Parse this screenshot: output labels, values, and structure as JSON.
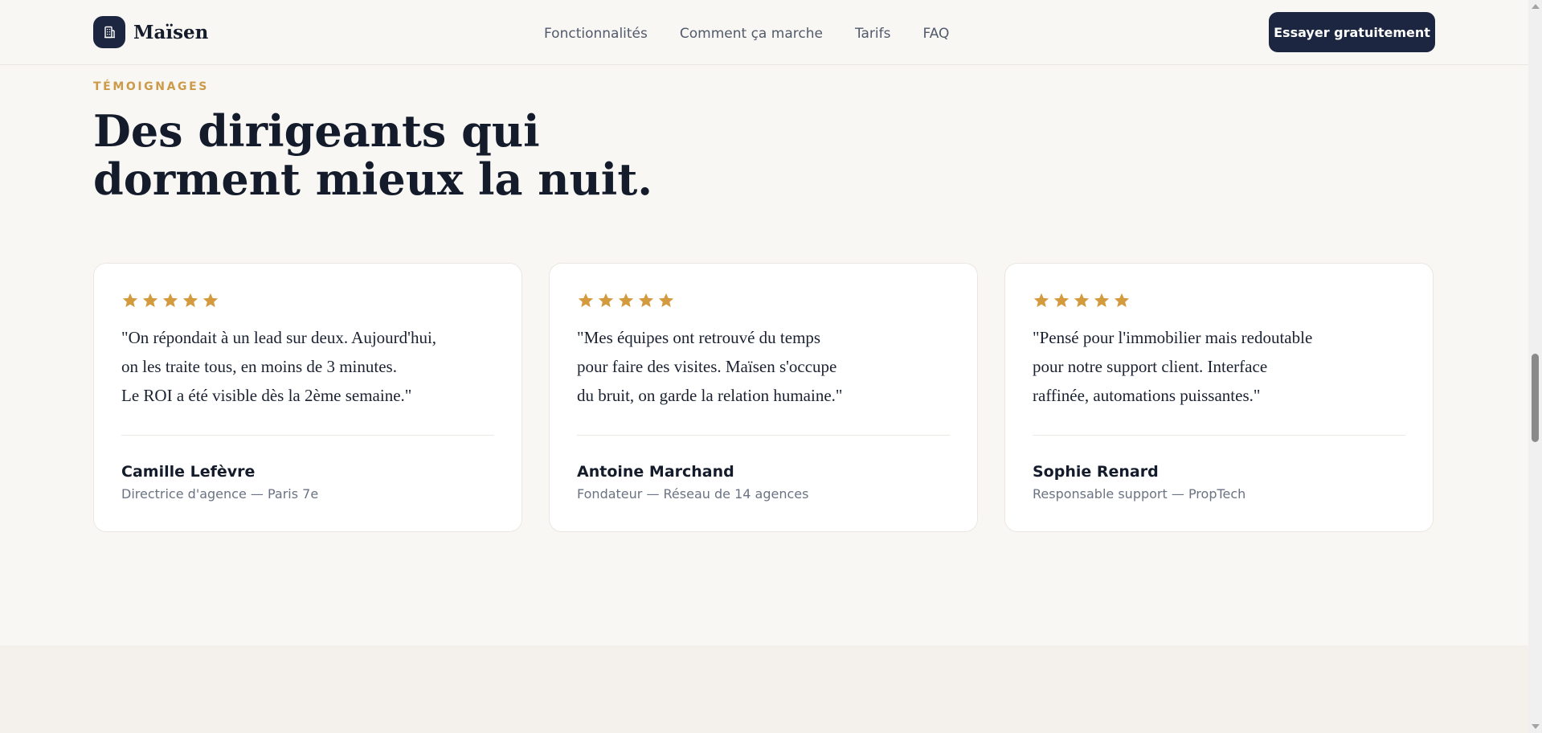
{
  "brand": {
    "name": "Maïsen",
    "icon": "building-icon",
    "color": "#1c2640"
  },
  "nav": {
    "items": [
      {
        "label": "Fonctionnalités"
      },
      {
        "label": "Comment ça marche"
      },
      {
        "label": "Tarifs"
      },
      {
        "label": "FAQ"
      }
    ]
  },
  "cta": {
    "label": "Essayer gratuitement"
  },
  "section": {
    "eyebrow": "TÉMOIGNAGES",
    "title_lines": [
      "Des dirigeants qui",
      "dorment mieux la nuit."
    ]
  },
  "colors": {
    "accent": "#cc9a48",
    "star": "#d49a3e",
    "background": "#f9f7f4"
  },
  "testimonials": [
    {
      "rating": 5,
      "quote_lines": [
        "\"On répondait à un lead sur deux. Aujourd'hui,",
        "on les traite tous, en moins de 3 minutes.",
        "Le ROI a été visible dès la 2ème semaine.\""
      ],
      "name": "Camille Lefèvre",
      "role": "Directrice d'agence — Paris 7e"
    },
    {
      "rating": 5,
      "quote_lines": [
        "\"Mes équipes ont retrouvé du temps",
        "pour faire des visites. Maïsen s'occupe",
        "du bruit, on garde la relation humaine.\""
      ],
      "name": "Antoine Marchand",
      "role": "Fondateur — Réseau de 14 agences"
    },
    {
      "rating": 5,
      "quote_lines": [
        "\"Pensé pour l'immobilier mais redoutable",
        "pour notre support client. Interface",
        "raffinée, automations puissantes.\""
      ],
      "name": "Sophie Renard",
      "role": "Responsable support — PropTech"
    }
  ]
}
